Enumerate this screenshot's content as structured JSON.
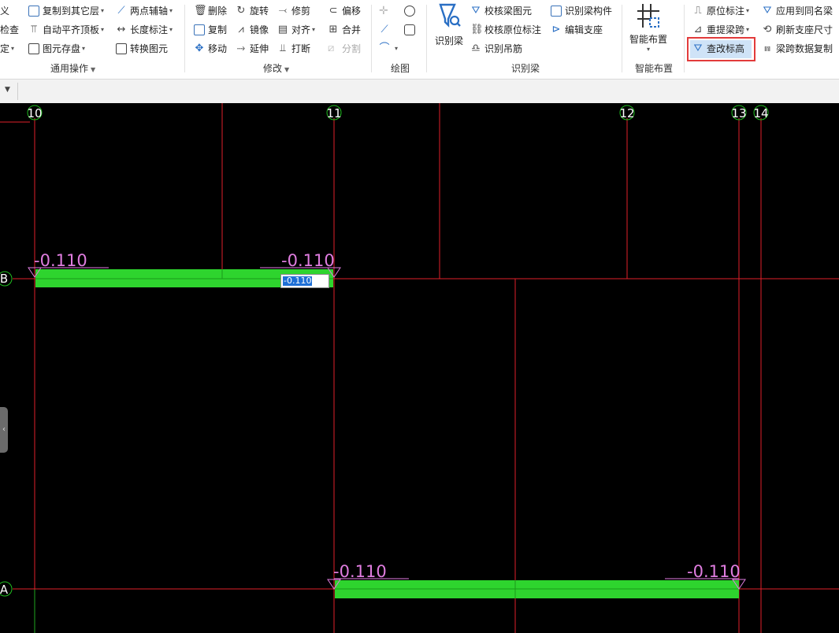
{
  "ribbon": {
    "col0": {
      "row1": "义",
      "row2": "检查",
      "row3": "定"
    },
    "common_ops": {
      "title": "通用操作",
      "copy_to_layer": "复制到其它层",
      "auto_align_top": "自动平齐顶板",
      "element_save": "图元存盘",
      "two_point_axis": "两点辅轴",
      "length_dim": "长度标注",
      "convert_element": "转换图元"
    },
    "modify": {
      "title": "修改",
      "delete": "删除",
      "rotate": "旋转",
      "trim": "修剪",
      "offset": "偏移",
      "copy": "复制",
      "mirror": "镜像",
      "align": "对齐",
      "merge": "合并",
      "move": "移动",
      "extend": "延伸",
      "break": "打断",
      "split": "分割"
    },
    "draw": {
      "title": "绘图"
    },
    "identify_beam": {
      "title": "识别梁",
      "big_label": "识别梁",
      "check_beam_element": "校核梁图元",
      "identify_beam_component": "识别梁构件",
      "check_in_situ_dim": "校核原位标注",
      "edit_support": "编辑支座",
      "identify_hanger": "识别吊筋"
    },
    "smart_layout": {
      "title": "智能布置",
      "big_label": "智能布置"
    },
    "beam_ops": {
      "in_situ_dim": "原位标注",
      "apply_same_name": "应用到同名梁",
      "re_extract_span": "重提梁跨",
      "refresh_support_size": "刷新支座尺寸",
      "check_change_elevation": "查改标高",
      "span_data_copy": "梁跨数据复制"
    }
  },
  "canvas": {
    "axes_vertical": [
      "10",
      "11",
      "12",
      "13",
      "14"
    ],
    "axes_horizontal": [
      "B",
      "A"
    ],
    "elevation_labels": {
      "b_left": "-0.110",
      "b_right": "-0.110",
      "a_left": "-0.110",
      "a_right": "-0.110"
    },
    "edit_value": "-0.110",
    "colors": {
      "grid": "#e0202a",
      "beam": "#2ed42e",
      "elevation": "#e07de0",
      "axis_bubble": "#1fbf1f"
    }
  }
}
